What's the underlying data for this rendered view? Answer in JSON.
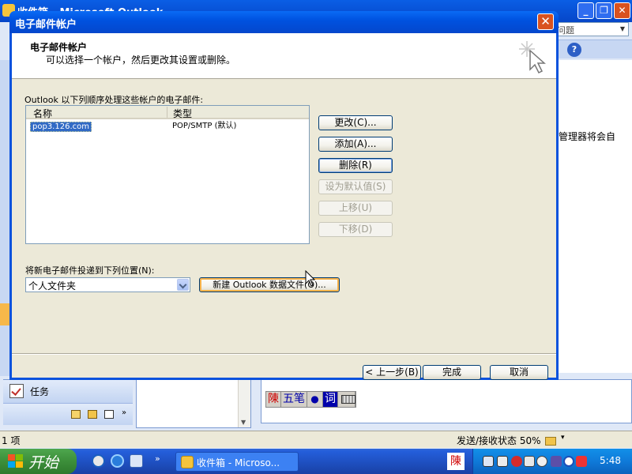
{
  "background": {
    "window_title": "收件箱 - Microsoft Outlook",
    "help_box_text": "问题",
    "help_icon_glyph": "?",
    "reading_pane_text": "管理器将会自",
    "nav_tasks_label": "任务",
    "nav_more_glyph": "»",
    "window_buttons": [
      "_",
      "❐",
      "✕"
    ]
  },
  "dialog": {
    "title": "电子邮件帐户",
    "close_glyph": "✕",
    "heading": "电子邮件帐户",
    "subheading": "可以选择一个帐户，然后更改其设置或删除。",
    "list_caption": "Outlook 以下列顺序处理这些帐户的电子邮件:",
    "columns": {
      "name": "名称",
      "type": "类型"
    },
    "accounts": [
      {
        "name": "pop3.126.com",
        "type": "POP/SMTP (默认)"
      }
    ],
    "buttons": {
      "change": "更改(C)...",
      "add": "添加(A)...",
      "remove": "删除(R)",
      "set_default": "设为默认值(S)",
      "move_up": "上移(U)",
      "move_down": "下移(D)"
    },
    "deliver_label": "将新电子邮件投递到下列位置(N):",
    "deliver_value": "个人文件夹",
    "new_datafile_button": "新建 Outlook 数据文件(O)...",
    "footer": {
      "back": "< 上一步(B)",
      "finish": "完成",
      "cancel": "取消"
    }
  },
  "ime": {
    "chen": "陳",
    "wubi": "五笔",
    "dot": "●",
    "ci": "词"
  },
  "statusbar": {
    "item_count": "1 项",
    "sync_status": "发送/接收状态 50%",
    "sync_arrow": "▾"
  },
  "taskbar": {
    "start_label": "开始",
    "task_item": "收件箱 - Microso...",
    "quick_launch_more": "»",
    "tray_ime": "陳",
    "clock": "5:48"
  },
  "colors": {
    "titlebar_blue": "#0052e0",
    "selection_blue": "#316ac5",
    "start_green": "#3c8e3a",
    "dialog_face": "#ece9d8"
  }
}
